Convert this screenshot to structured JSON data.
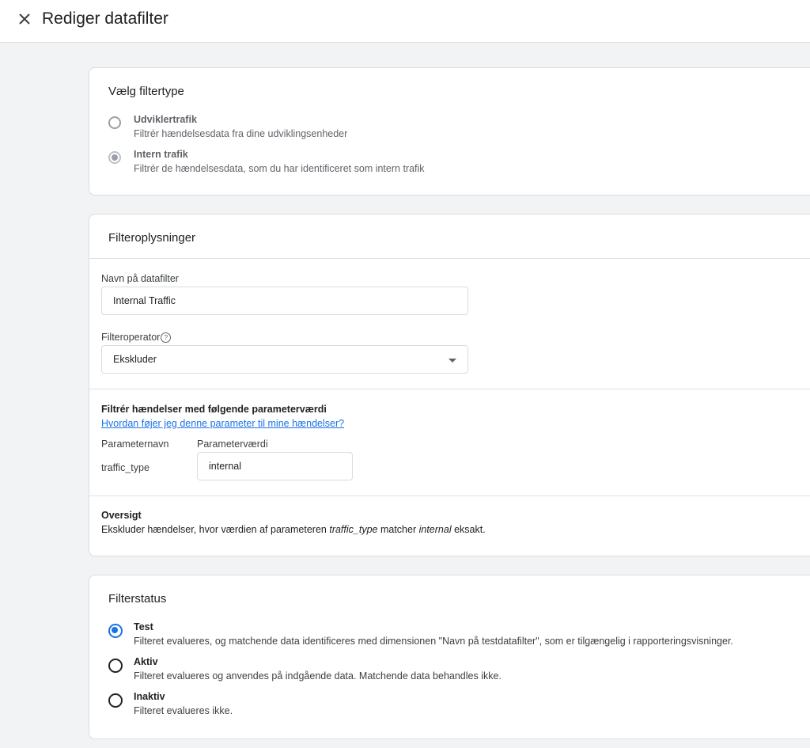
{
  "header": {
    "title": "Rediger datafilter",
    "close_icon": "close-icon"
  },
  "filter_type": {
    "title": "Vælg filtertype",
    "options": [
      {
        "label": "Udviklertrafik",
        "description": "Filtrér hændelsesdata fra dine udviklingsenheder",
        "selected": false
      },
      {
        "label": "Intern trafik",
        "description": "Filtrér de hændelsesdata, som du har identificeret som intern trafik",
        "selected": true
      }
    ]
  },
  "filter_details": {
    "title": "Filteroplysninger",
    "name_label": "Navn på datafilter",
    "name_value": "Internal Traffic",
    "operator_label": "Filteroperator",
    "operator_value": "Ekskluder",
    "param_heading": "Filtrér hændelser med følgende parameterværdi",
    "param_help_link": "Hvordan føjer jeg denne parameter til mine hændelser?",
    "param_name_header": "Parameternavn",
    "param_value_header": "Parameterværdi",
    "param_name": "traffic_type",
    "param_value": "internal",
    "summary_title": "Oversigt",
    "summary": {
      "prefix": "Ekskluder hændelser, hvor værdien af parameteren ",
      "param": "traffic_type",
      "middle": " matcher ",
      "value": "internal",
      "suffix": " eksakt."
    }
  },
  "filter_status": {
    "title": "Filterstatus",
    "options": [
      {
        "label": "Test",
        "description": "Filteret evalueres, og matchende data identificeres med dimensionen \"Navn på testdatafilter\", som er tilgængelig i rapporteringsvisninger.",
        "selected": true
      },
      {
        "label": "Aktiv",
        "description": "Filteret evalueres og anvendes på indgående data. Matchende data behandles ikke.",
        "selected": false
      },
      {
        "label": "Inaktiv",
        "description": "Filteret evalueres ikke.",
        "selected": false
      }
    ]
  },
  "colors": {
    "accent": "#1a73e8",
    "background": "#f1f3f4",
    "border": "#dadce0"
  }
}
